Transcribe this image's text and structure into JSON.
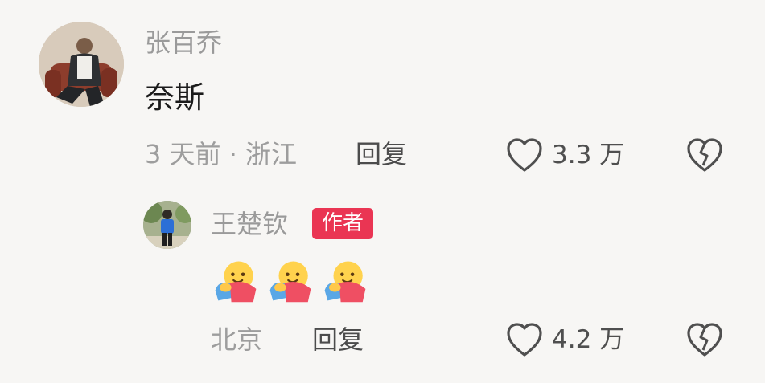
{
  "comment": {
    "username": "张百乔",
    "text": "奈斯",
    "meta": "3 天前 · 浙江",
    "reply_label": "回复",
    "like_count": "3.3 万",
    "avatar_icon": "user-avatar-photo"
  },
  "reply": {
    "username": "王楚钦",
    "badge": "作者",
    "emoji_icon": "hugging-face-emoji",
    "emoji_count": 3,
    "meta": "北京",
    "reply_label": "回复",
    "like_count": "4.2 万",
    "avatar_icon": "user-avatar-photo"
  },
  "colors": {
    "background": "#f7f6f4",
    "badge": "#ea3553",
    "muted_text": "#9a9a9a",
    "icon": "#4f4f4f"
  }
}
